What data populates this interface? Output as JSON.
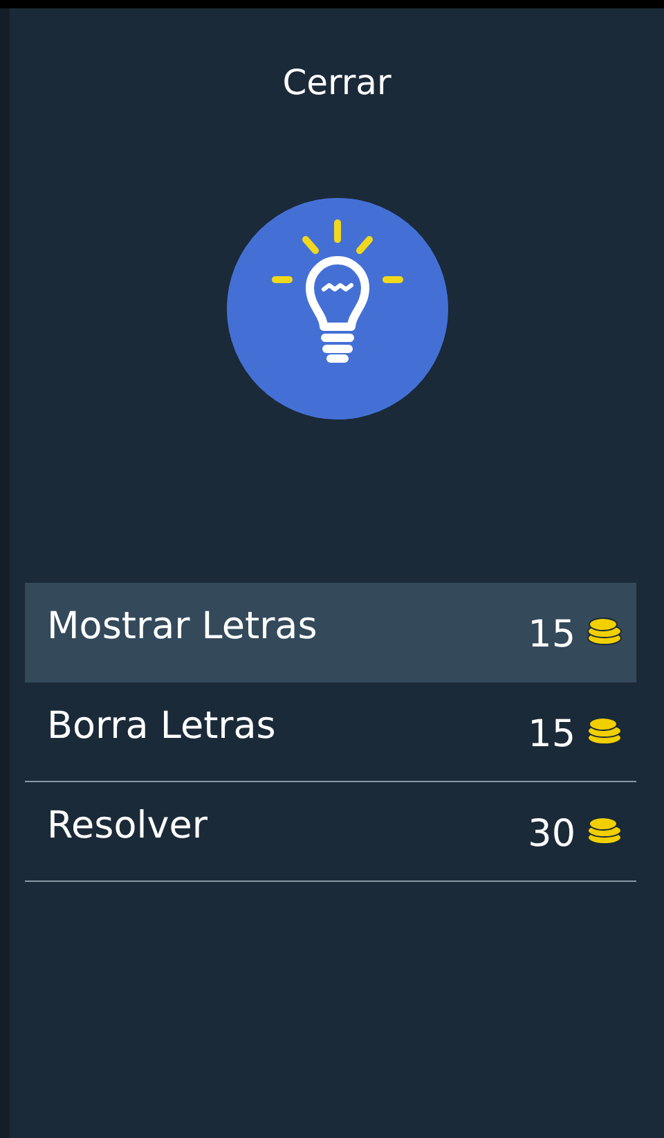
{
  "close_button": {
    "label": "Cerrar"
  },
  "options": [
    {
      "label": "Mostrar Letras",
      "cost": "15",
      "selected": true
    },
    {
      "label": "Borra Letras",
      "cost": "15",
      "selected": false
    },
    {
      "label": "Resolver",
      "cost": "30",
      "selected": false
    }
  ]
}
